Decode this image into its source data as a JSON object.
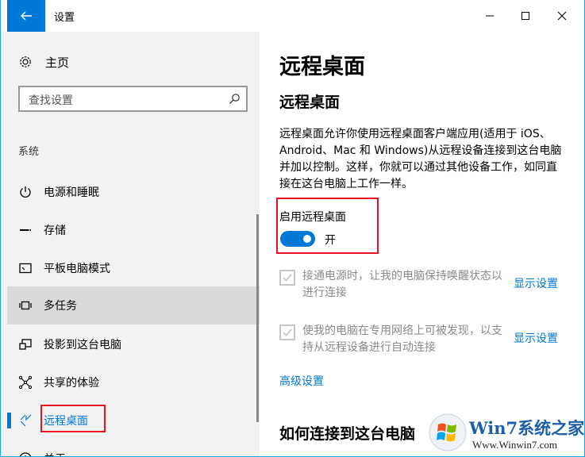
{
  "window": {
    "title": "设置",
    "accent": "#0078d7",
    "highlight": "#e81123"
  },
  "sidebar": {
    "home_label": "主页",
    "search_placeholder": "查找设置",
    "section_label": "系统",
    "items": [
      {
        "label": "电源和睡眠",
        "icon": "power-icon"
      },
      {
        "label": "存储",
        "icon": "storage-icon"
      },
      {
        "label": "平板电脑模式",
        "icon": "tablet-mode-icon"
      },
      {
        "label": "多任务",
        "icon": "multitasking-icon",
        "hovered": true
      },
      {
        "label": "投影到这台电脑",
        "icon": "projecting-icon"
      },
      {
        "label": "共享的体验",
        "icon": "shared-experiences-icon"
      },
      {
        "label": "远程桌面",
        "icon": "remote-desktop-icon",
        "selected": true
      },
      {
        "label": "关于",
        "icon": "about-icon"
      }
    ]
  },
  "main": {
    "page_title": "远程桌面",
    "section_title": "远程桌面",
    "description": "远程桌面允许你使用远程桌面客户端应用(适用于 iOS、Android、Mac 和 Windows)从远程设备连接到这台电脑并加以控制。这样，你就可以通过其他设备工作，如同直接在这台电脑上工作一样。",
    "toggle": {
      "label": "启用远程桌面",
      "state_text": "开",
      "on": true
    },
    "options": [
      {
        "text": "接通电源时，让我的电脑保持唤醒状态以进行连接",
        "link": "显示设置",
        "checked": true,
        "disabled": true
      },
      {
        "text": "使我的电脑在专用网络上可被发现，以支持从远程设备进行自动连接",
        "link": "显示设置",
        "checked": true,
        "disabled": true
      }
    ],
    "advanced_link": "高级设置",
    "howto_title": "如何连接到这台电脑"
  },
  "watermark": {
    "title": "Win7系统之家",
    "url": "Www.Winwin7.com"
  }
}
